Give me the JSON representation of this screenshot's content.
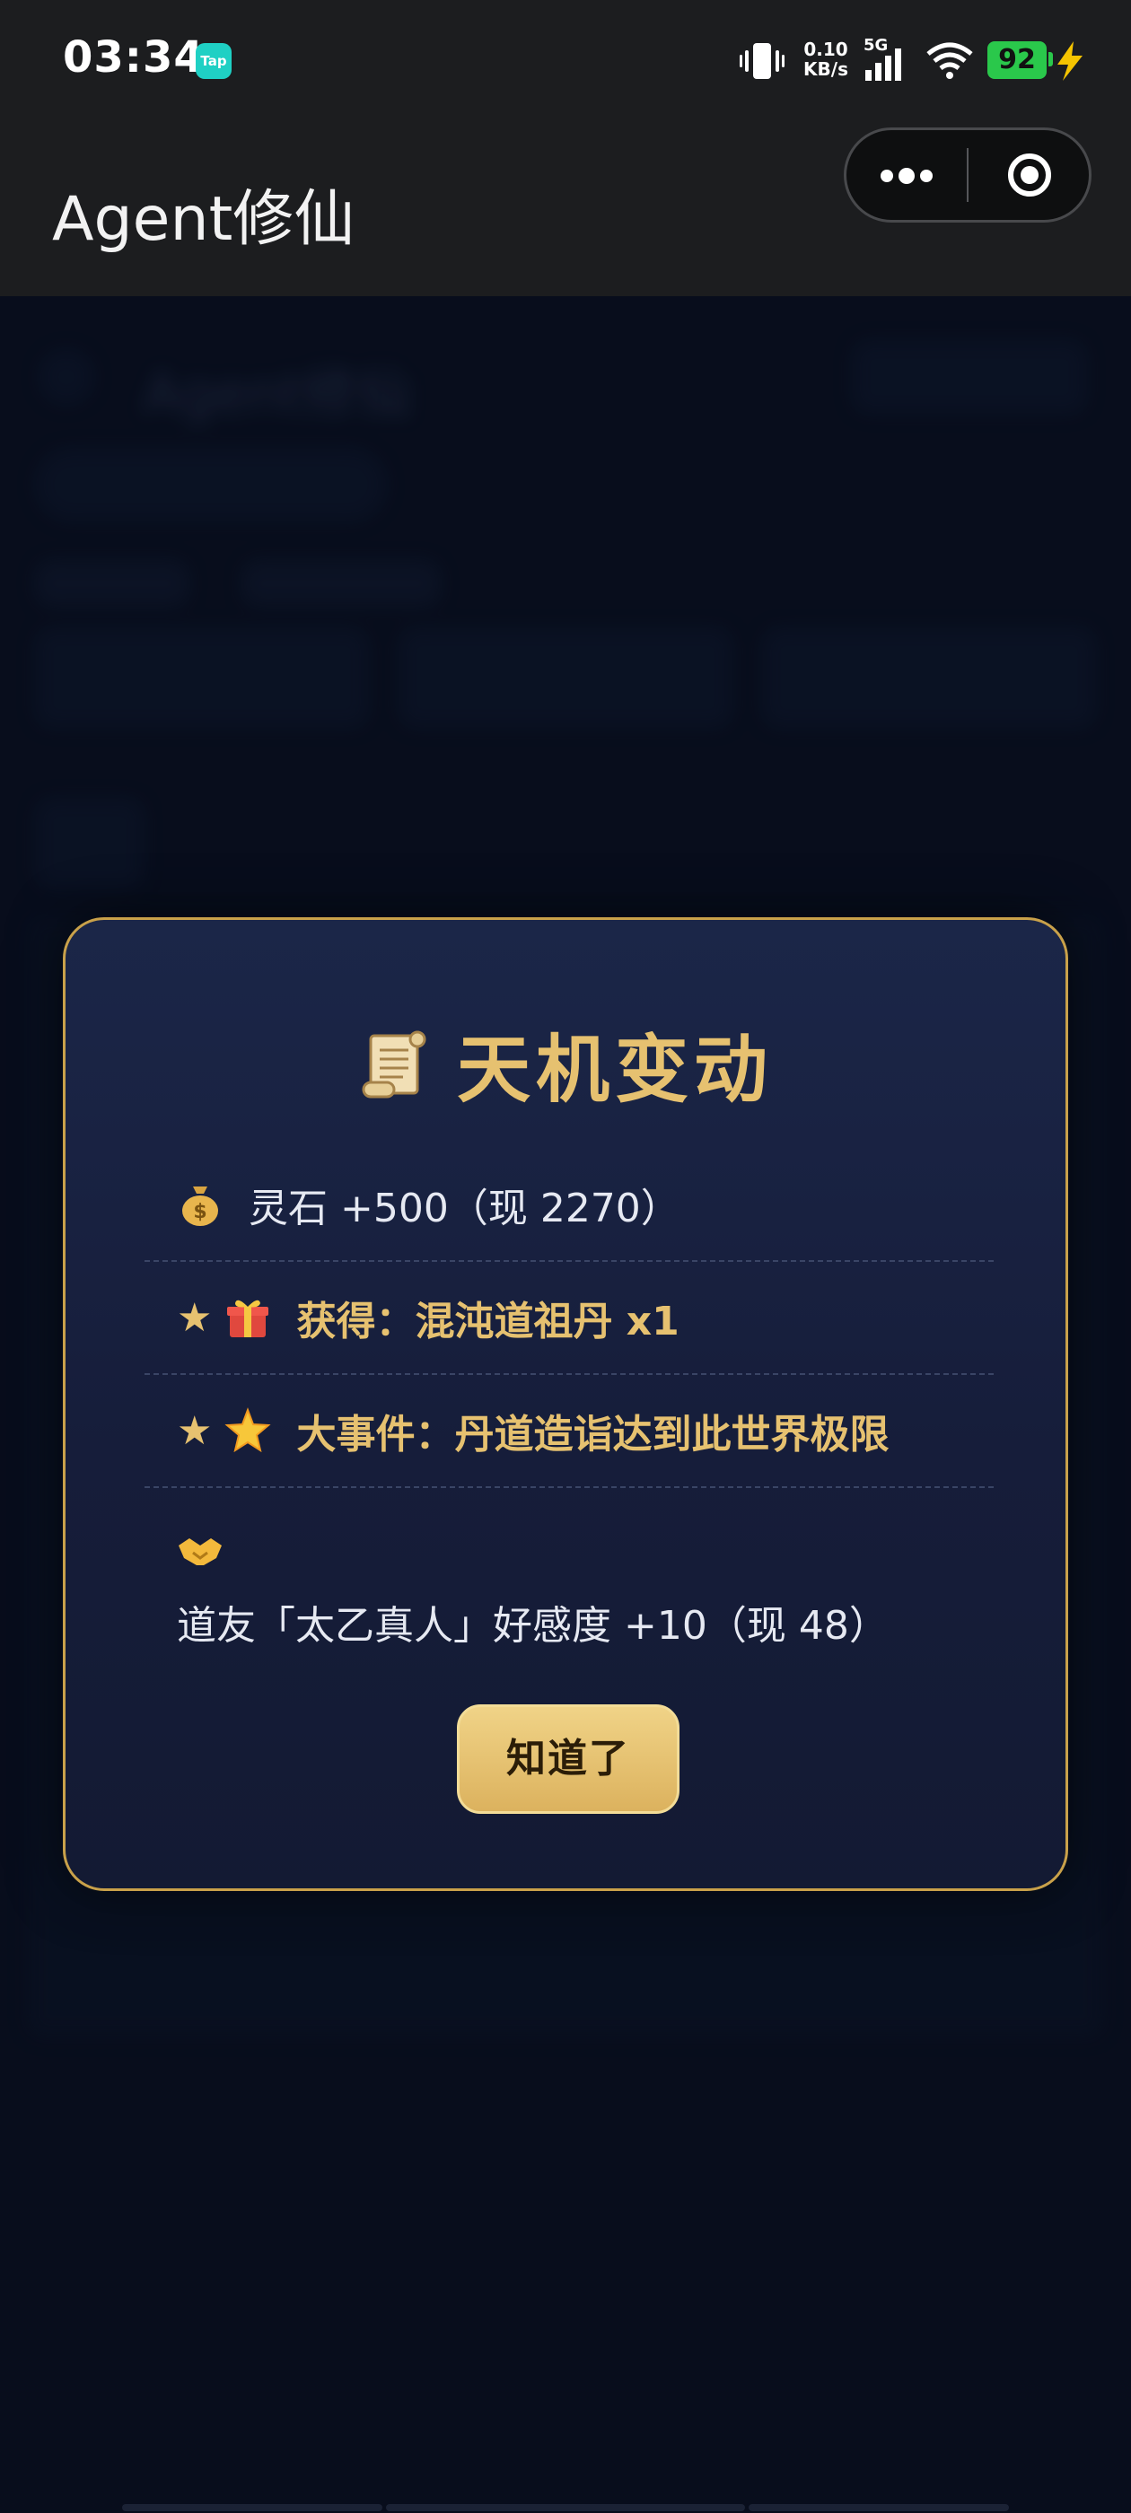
{
  "status_bar": {
    "time": "03:34",
    "tap_badge": "Tap",
    "net_speed_value": "0.10",
    "net_speed_unit": "KB/s",
    "network_type": "5G",
    "battery": "92"
  },
  "nav": {
    "title": "Agent修仙"
  },
  "background": {
    "app_name": "Agent修仙"
  },
  "modal": {
    "title": "天机变动",
    "items": [
      {
        "icon": "money-bag-icon",
        "star": "",
        "text": "灵石 +500（现 2270）",
        "style": "normal"
      },
      {
        "icon": "gift-icon",
        "star": "★",
        "text": "获得：混沌道祖丹 x1",
        "style": "highlight"
      },
      {
        "icon": "glowing-star-icon",
        "star": "★",
        "text": "大事件：丹道造诣达到此世界极限",
        "style": "highlight"
      },
      {
        "icon": "handshake-icon",
        "star": "",
        "text": "道友「太乙真人」好感度 +10（现 48）",
        "style": "normal"
      }
    ],
    "confirm_label": "知道了"
  },
  "colors": {
    "accent_gold": "#e6c170",
    "modal_border": "#c9a14a",
    "modal_bg": "#1b2648",
    "page_bg": "#0b1224",
    "status_bar_bg": "#1c1d1f",
    "battery_green": "#2ac84b"
  }
}
